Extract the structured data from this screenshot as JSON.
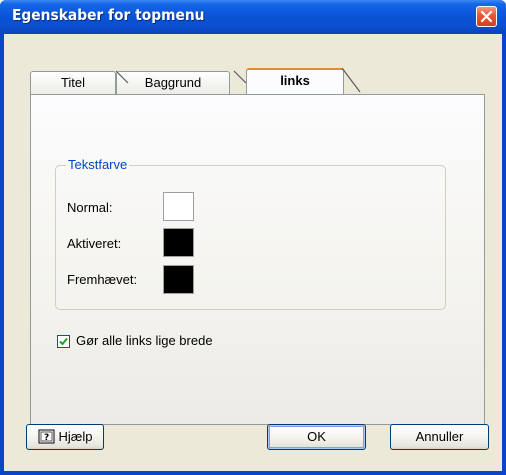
{
  "window": {
    "title": "Egenskaber for topmenu",
    "close_icon": "close-icon"
  },
  "tabs": [
    {
      "label": "Titel",
      "active": false
    },
    {
      "label": "Baggrund",
      "active": false
    },
    {
      "label": "links",
      "active": true
    }
  ],
  "group": {
    "legend": "Tekstfarve",
    "legend_color": "#0046d5",
    "rows": [
      {
        "label": "Normal:",
        "color": "#ffffff"
      },
      {
        "label": "Aktiveret:",
        "color": "#000000"
      },
      {
        "label": "Fremhævet:",
        "color": "#000000"
      }
    ]
  },
  "checkbox": {
    "label": "Gør alle links lige brede",
    "checked": true
  },
  "buttons": {
    "help": "Hjælp",
    "help_icon": "help-book-icon",
    "ok": "OK",
    "cancel": "Annuller"
  }
}
